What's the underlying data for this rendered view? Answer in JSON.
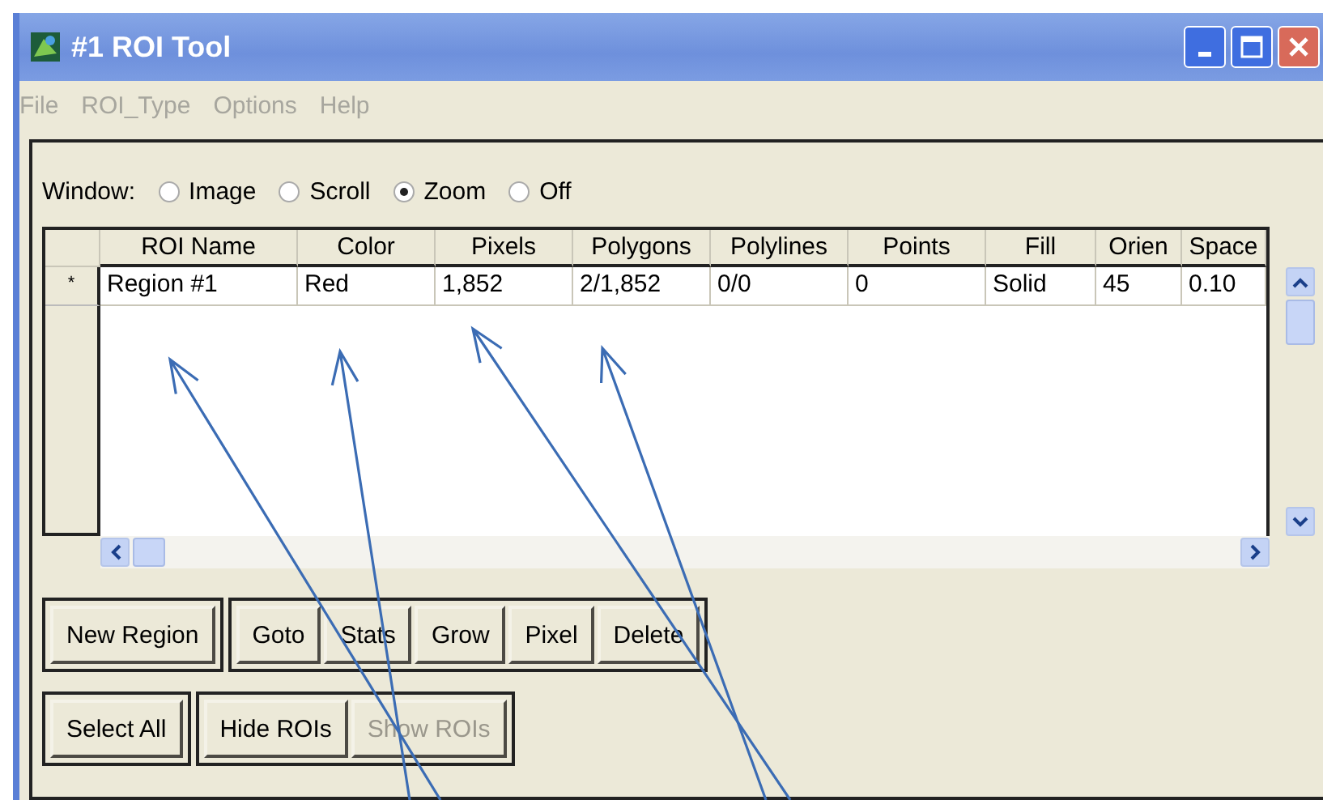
{
  "window": {
    "title": "#1 ROI Tool"
  },
  "menu": [
    {
      "label": "File",
      "disabled": true
    },
    {
      "label": "ROI_Type",
      "disabled": true
    },
    {
      "label": "Options",
      "disabled": true
    },
    {
      "label": "Help",
      "disabled": true
    }
  ],
  "window_mode": {
    "label": "Window:",
    "options": [
      {
        "label": "Image",
        "selected": false
      },
      {
        "label": "Scroll",
        "selected": false
      },
      {
        "label": "Zoom",
        "selected": true
      },
      {
        "label": "Off",
        "selected": false
      }
    ]
  },
  "table": {
    "columns": [
      "ROI Name",
      "Color",
      "Pixels",
      "Polygons",
      "Polylines",
      "Points",
      "Fill",
      "Orien",
      "Space"
    ],
    "rows": [
      {
        "marker": "*",
        "cells": [
          "Region #1",
          "Red",
          "1,852",
          "2/1,852",
          "0/0",
          "0",
          "Solid",
          "45",
          "0.10"
        ]
      }
    ]
  },
  "button_groups": [
    [
      {
        "label": "New Region",
        "disabled": false
      }
    ],
    [
      {
        "label": "Goto",
        "disabled": false
      },
      {
        "label": "Stats",
        "disabled": false
      },
      {
        "label": "Grow",
        "disabled": false
      },
      {
        "label": "Pixel",
        "disabled": false
      },
      {
        "label": "Delete",
        "disabled": false
      }
    ],
    [
      {
        "label": "Select All",
        "disabled": false
      }
    ],
    [
      {
        "label": "Hide ROIs",
        "disabled": false
      },
      {
        "label": "Show ROIs",
        "disabled": true
      }
    ]
  ]
}
